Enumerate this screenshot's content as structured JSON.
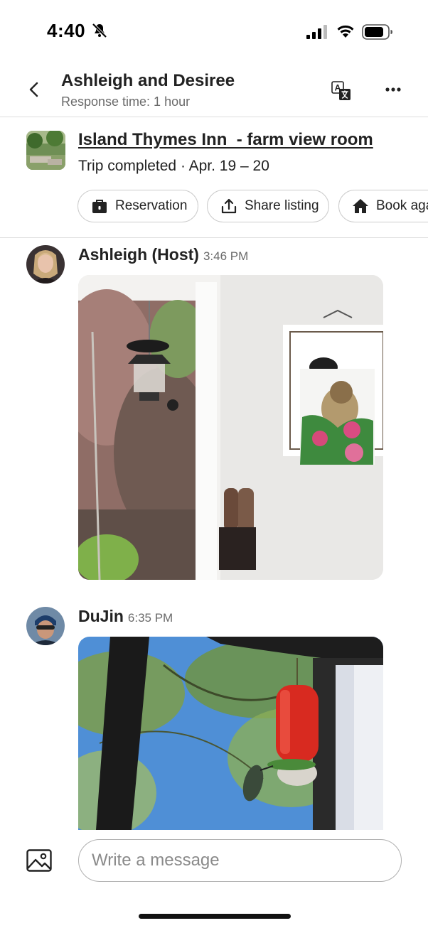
{
  "status_bar": {
    "time": "4:40",
    "icons": [
      "bell-slash-icon",
      "signal-icon",
      "wifi-icon",
      "battery-icon"
    ]
  },
  "header": {
    "title": "Ashleigh and Desiree",
    "subtitle": "Response time: 1 hour",
    "icons": [
      "back-icon",
      "translate-icon",
      "more-icon"
    ]
  },
  "listing": {
    "title": "Island Thymes Inn  - farm view room",
    "status": "Trip completed · Apr. 19 – 20",
    "actions": [
      {
        "label": "Reservation",
        "icon": "briefcase-icon"
      },
      {
        "label": "Share listing",
        "icon": "share-icon"
      },
      {
        "label": "Book again",
        "icon": "home-icon"
      }
    ]
  },
  "messages": [
    {
      "sender": "Ashleigh (Host)",
      "time": "3:46 PM",
      "attachment": "photo"
    },
    {
      "sender": "DuJin",
      "time": "6:35 PM",
      "attachment": "photo"
    }
  ],
  "composer": {
    "placeholder": "Write a message",
    "icon": "image-icon"
  },
  "colors": {
    "text": "#222222",
    "secondary_text": "#6a6a6a",
    "divider": "#dddddd",
    "chip_border": "#cccccc"
  }
}
